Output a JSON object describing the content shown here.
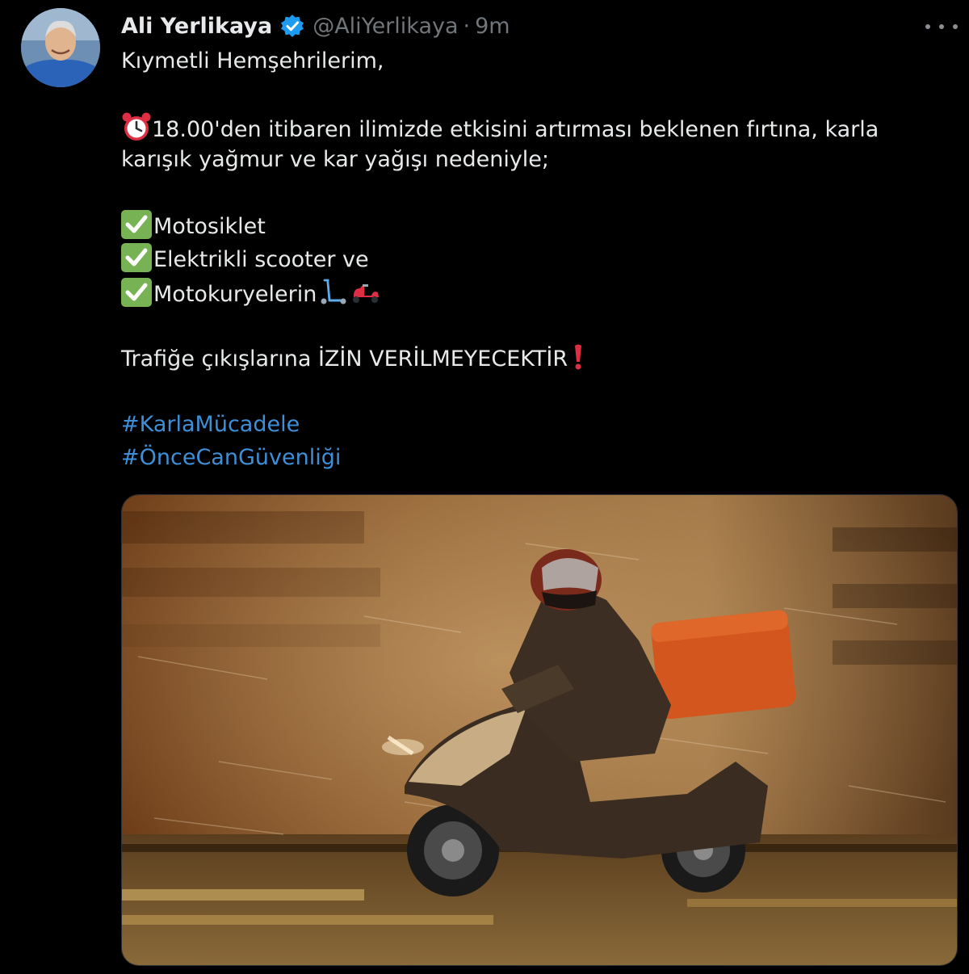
{
  "author": {
    "display_name": "Ali Yerlikaya",
    "handle": "@AliYerlikaya",
    "separator": "·",
    "time": "9m"
  },
  "tweet": {
    "greeting": "Kıymetli Hemşehrilerim,",
    "line1": "18.00'den itibaren ilimizde etkisini artırması beklenen fırtına, karla",
    "line2": "karışık yağmur ve kar yağışı nedeniyle;",
    "item1": "Motosiklet",
    "item2": "Elektrikli scooter ve",
    "item3": "Motokuryelerin",
    "warning": "Trafiğe çıkışlarına İZİN VERİLMEYECEKTİR",
    "hashtag1": "#KarlaMücadele",
    "hashtag2": "#ÖnceCanGüvenliği"
  },
  "icons": [
    "verified-badge-icon",
    "more-options-icon",
    "alarm-clock-icon",
    "check-mark-icon",
    "kick-scooter-icon",
    "motor-scooter-icon",
    "exclamation-icon"
  ],
  "colors": {
    "background": "#000000",
    "text": "#e7e9ea",
    "secondary": "#71767b",
    "link": "#3f8fd8",
    "verified": "#1d9bf0",
    "check": "#77b255",
    "exclamation": "#dd2e44"
  }
}
